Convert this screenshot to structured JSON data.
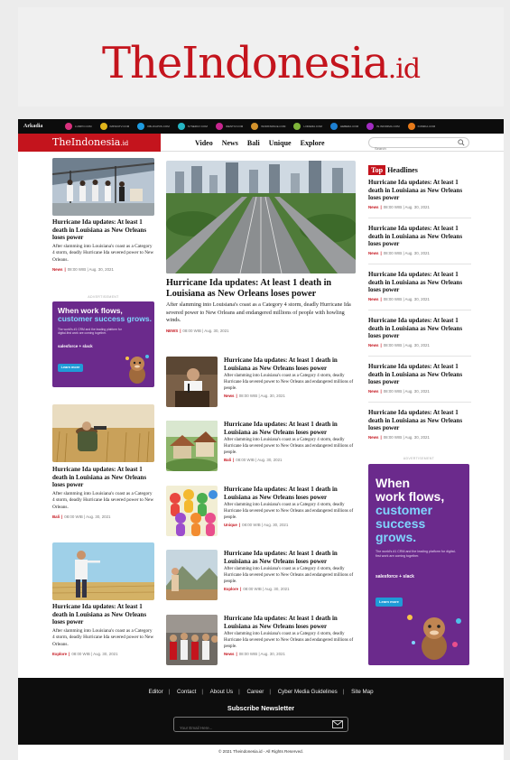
{
  "brand": {
    "name": "TheIndonesia",
    "tld": ".id"
  },
  "network": {
    "brand": "Arkadia",
    "sites": [
      {
        "label": "LUMPO.COM",
        "color": "#d9317d"
      },
      {
        "label": "IMPIANTV.COM",
        "color": "#e0b41b"
      },
      {
        "label": "KBLOGPOS.COM",
        "color": "#1e9be0"
      },
      {
        "label": "SYNERGY.COM",
        "color": "#26b6c4"
      },
      {
        "label": "IDENTIV.COM",
        "color": "#c7268f"
      },
      {
        "label": "WORKSPACE.COM",
        "color": "#d3922c"
      },
      {
        "label": "LOREMA.COM",
        "color": "#7fb43a"
      },
      {
        "label": "HEBERA.COM",
        "color": "#1d7fd1"
      },
      {
        "label": "IN.INFORMA.COM",
        "color": "#a22cc2"
      },
      {
        "label": "KOMIKA.COM",
        "color": "#e77a1a"
      }
    ]
  },
  "nav": {
    "links": [
      "Video",
      "News",
      "Bali",
      "Unique",
      "Explore"
    ],
    "search_placeholder": "Search"
  },
  "left": {
    "articles": [
      {
        "title": "Hurricane Ida updates: At least 1 death in Louisiana as New Orleans loses power",
        "excerpt": "After slamming into Louisiana's coast as a Category 4 storm, deadly Hurricane Ida severed power to New Orleans.",
        "category": "News",
        "time": "08:00 WIB | Aug. 30, 2021"
      },
      {
        "title": "Hurricane Ida updates: At least 1 death in Louisiana as New Orleans loses power",
        "excerpt": "After slamming into Louisiana's coast as a Category 4 storm, deadly Hurricane Ida severed power to New Orleans.",
        "category": "Bali",
        "time": "08:00 WIB | Aug. 30, 2021"
      },
      {
        "title": "Hurricane Ida updates: At least 1 death in Louisiana as New Orleans loses power",
        "excerpt": "After slamming into Louisiana's coast as a Category 4 storm, deadly Hurricane Ida severed power to New Orleans.",
        "category": "Explore",
        "time": "08:00 WIB | Aug. 30, 2021"
      }
    ],
    "ad": {
      "label": "ADVERTISEMENT",
      "line1": "When work flows,",
      "line2": "customer success grows.",
      "sub": "The world's #1 CRM and the leading platform for digital-first work are coming together.",
      "partners": "salesforce + slack",
      "cta": "Learn more"
    }
  },
  "featured": {
    "title": "Hurricane Ida updates: At least 1 death in Louisiana as New Orleans loses power",
    "excerpt": "After slamming into Louisiana's coast as a Category 4 storm, deadly Hurricane Ida severed power to New Orleans and endangered millions of people with howling winds.",
    "category": "NEWS",
    "time": "08:00 WIB | Aug. 30, 2021"
  },
  "center_list": [
    {
      "title": "Hurricane Ida updates: At least 1 death in Louisiana as New Orleans loses power",
      "excerpt": "After slamming into Louisiana's coast as a Category 4 storm, deadly Hurricane Ida severed power to New Orleans and endangered millions of people.",
      "category": "News",
      "time": "08:00 WIB | Aug. 30, 2021"
    },
    {
      "title": "Hurricane Ida updates: At least 1 death in Louisiana as New Orleans loses power",
      "excerpt": "After slamming into Louisiana's coast as a Category 4 storm, deadly Hurricane Ida severed power to New Orleans and endangered millions of people.",
      "category": "Bali",
      "time": "08:00 WIB | Aug. 30, 2021"
    },
    {
      "title": "Hurricane Ida updates: At least 1 death in Louisiana as New Orleans loses power",
      "excerpt": "After slamming into Louisiana's coast as a Category 4 storm, deadly Hurricane Ida severed power to New Orleans and endangered millions of people.",
      "category": "Unique",
      "time": "08:00 WIB | Aug. 30, 2021"
    },
    {
      "title": "Hurricane Ida updates: At least 1 death in Louisiana as New Orleans loses power",
      "excerpt": "After slamming into Louisiana's coast as a Category 4 storm, deadly Hurricane Ida severed power to New Orleans and endangered millions of people.",
      "category": "Explore",
      "time": "08:00 WIB | Aug. 30, 2021"
    },
    {
      "title": "Hurricane Ida updates: At least 1 death in Louisiana as New Orleans loses power",
      "excerpt": "After slamming into Louisiana's coast as a Category 4 storm, deadly Hurricane Ida severed power to New Orleans and endangered millions of people.",
      "category": "News",
      "time": "08:00 WIB | Aug. 30, 2021"
    }
  ],
  "headlines": {
    "badge": "Top",
    "title": "Headlines",
    "items": [
      {
        "title": "Hurricane Ida updates: At least 1 death in Louisiana as New Orleans loses power",
        "category": "News",
        "time": "08:00 WIB | Aug. 30, 2021"
      },
      {
        "title": "Hurricane Ida updates: At least 1 death in Louisiana as New Orleans loses power",
        "category": "News",
        "time": "08:00 WIB | Aug. 30, 2021"
      },
      {
        "title": "Hurricane Ida updates: At least 1 death in Louisiana as New Orleans loses power",
        "category": "News",
        "time": "08:00 WIB | Aug. 30, 2021"
      },
      {
        "title": "Hurricane Ida updates: At least 1 death in Louisiana as New Orleans loses power",
        "category": "News",
        "time": "08:00 WIB | Aug. 30, 2021"
      },
      {
        "title": "Hurricane Ida updates: At least 1 death in Louisiana as New Orleans loses power",
        "category": "News",
        "time": "08:00 WIB | Aug. 30, 2021"
      },
      {
        "title": "Hurricane Ida updates: At least 1 death in Louisiana as New Orleans loses power",
        "category": "News",
        "time": "08:00 WIB | Aug. 30, 2021"
      }
    ]
  },
  "right_ad": {
    "label": "ADVERTISEMENT",
    "line1": "When",
    "line2": "work flows,",
    "line3": "customer",
    "line4": "success",
    "line5": "grows.",
    "sub": "The world's #1 CRM and the leading platform for digital-first work are coming together.",
    "partners": "salesforce + slack",
    "cta": "Learn more"
  },
  "footer": {
    "links": [
      "Editor",
      "Contact",
      "About Us",
      "Career",
      "Cyber Media Guidelines",
      "Site Map"
    ],
    "subscribe": "Subscribe Newsletter",
    "email_placeholder": "Your Email Here...",
    "copyright": "© 2021 Theindonesia.id - All Rights Reserved."
  },
  "colors": {
    "accent": "#c4141d",
    "ad_purple": "#6b2a8c",
    "footer": "#0d0d0d"
  }
}
